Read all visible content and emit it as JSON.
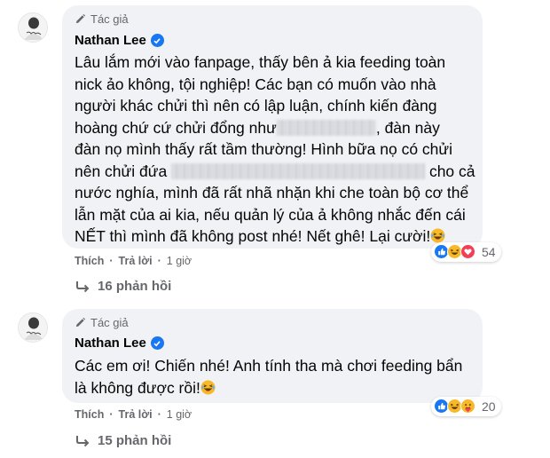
{
  "comments": [
    {
      "author_tag": "Tác giả",
      "author_name": "Nathan Lee",
      "lines": [
        "Lâu lắm mới vào fanpage, thấy bên ả kia feeding toàn",
        "nick ảo không, tội nghiệp! Các bạn có muốn vào nhà",
        "người khác chửi thì nên có lập luận, chính kiến đàng",
        "hoàng chứ cứ chửi đổng như",
        ", đàn này",
        "đàn nọ mình thấy rất tầm thường! Hình bữa nọ có chửi",
        "nên chửi đứa",
        "cho cả",
        "nước nghía, mình đã rất nhã nhặn khi che toàn bộ cơ thể",
        "lẫn mặt của ai kia, nếu quản lý của ả không nhắc đến cái",
        "NẾT thì mình đã không post nhé! Nết ghê! Lại cười!"
      ],
      "actions": {
        "like": "Thích",
        "reply": "Trả lời",
        "time": "1 giờ"
      },
      "reactions": [
        "like-icon",
        "haha-icon",
        "love-icon"
      ],
      "reaction_count": "54",
      "replies_label": "16 phản hồi"
    },
    {
      "author_tag": "Tác giả",
      "author_name": "Nathan Lee",
      "lines": [
        "Các em ơi! Chiến nhé! Anh tính tha mà chơi feeding bẩn",
        "là không được rồi!"
      ],
      "actions": {
        "like": "Thích",
        "reply": "Trả lời",
        "time": "1 giờ"
      },
      "reactions": [
        "like-icon",
        "haha-icon",
        "care-icon"
      ],
      "reaction_count": "20",
      "replies_label": "15 phản hồi"
    }
  ],
  "colors": {
    "bubble": "#f0f2f5",
    "verified": "#1877f2",
    "secondary_text": "#65676b",
    "love": "#f33e58",
    "haha": "#f7b928"
  }
}
